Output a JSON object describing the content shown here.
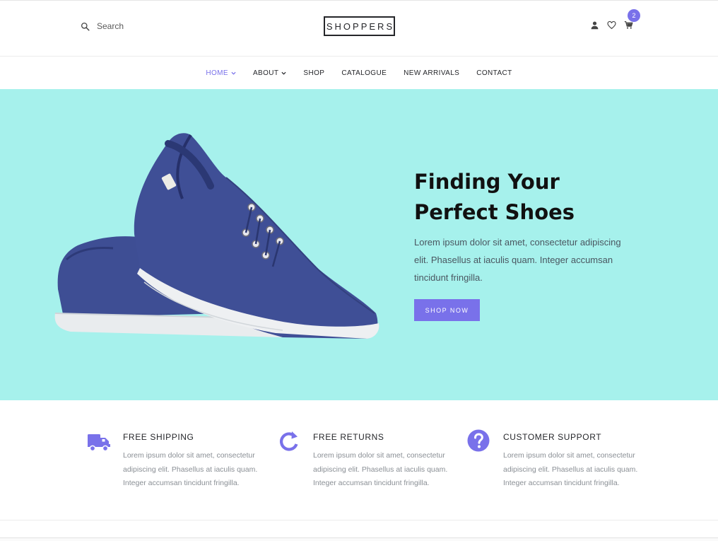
{
  "header": {
    "search_placeholder": "Search",
    "logo": "SHOPPERS",
    "icons": [
      "user-icon",
      "heart-icon",
      "cart-icon"
    ],
    "cart_count": "2"
  },
  "nav": {
    "items": [
      {
        "label": "HOME",
        "dropdown": true,
        "active": true
      },
      {
        "label": "ABOUT",
        "dropdown": true,
        "active": false
      },
      {
        "label": "SHOP",
        "dropdown": false,
        "active": false
      },
      {
        "label": "CATALOGUE",
        "dropdown": false,
        "active": false
      },
      {
        "label": "NEW ARRIVALS",
        "dropdown": false,
        "active": false
      },
      {
        "label": "CONTACT",
        "dropdown": false,
        "active": false
      }
    ]
  },
  "hero": {
    "title_line1": "Finding Your",
    "title_line2": "Perfect Shoes",
    "copy": "Lorem ipsum dolor sit amet, consectetur adipiscing elit. Phasellus at iaculis quam. Integer accumsan tincidunt fringilla.",
    "button": "SHOP NOW",
    "image": "blue-canvas-sneakers"
  },
  "features": [
    {
      "icon": "truck-icon",
      "title": "FREE SHIPPING",
      "text": "Lorem ipsum dolor sit amet, consectetur adipiscing elit. Phasellus at iaculis quam. Integer accumsan tincidunt fringilla."
    },
    {
      "icon": "refresh-icon",
      "title": "FREE RETURNS",
      "text": "Lorem ipsum dolor sit amet, consectetur adipiscing elit. Phasellus at iaculis quam. Integer accumsan tincidunt fringilla."
    },
    {
      "icon": "help-icon",
      "title": "CUSTOMER SUPPORT",
      "text": "Lorem ipsum dolor sit amet, consectetur adipiscing elit. Phasellus at iaculis quam. Integer accumsan tincidunt fringilla."
    }
  ],
  "colors": {
    "accent": "#7971ea",
    "hero_bg": "#a6f1ec",
    "text": "#25262a"
  }
}
